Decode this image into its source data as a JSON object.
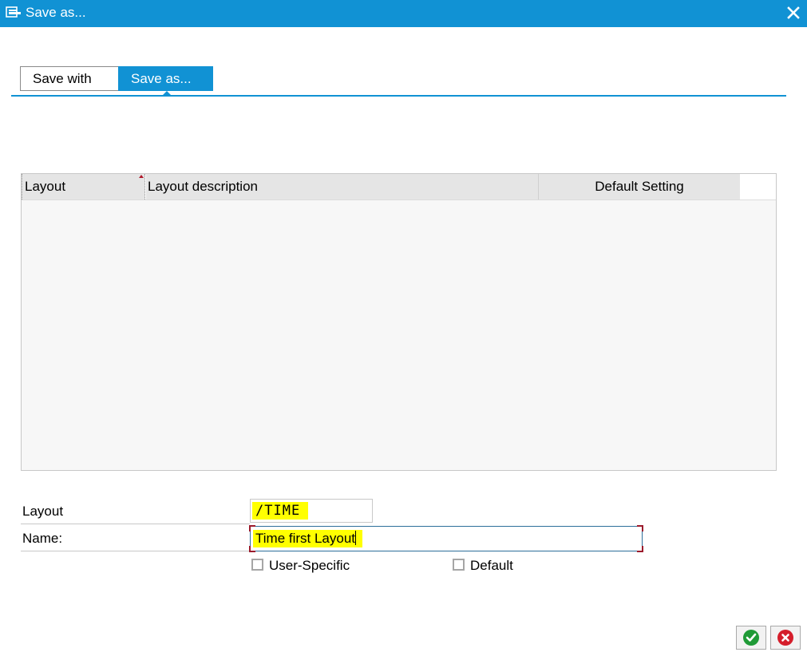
{
  "window": {
    "title": "Save as...",
    "close_icon": "close-icon",
    "title_icon": "save-layout-icon"
  },
  "tabs": [
    {
      "label": "Save with",
      "active": false
    },
    {
      "label": "Save as...",
      "active": true
    }
  ],
  "grid": {
    "columns": [
      "Layout",
      "Layout description",
      "Default Setting"
    ],
    "rows": []
  },
  "form": {
    "layout_label": "Layout",
    "layout_value": "/TIME",
    "name_label": "Name:",
    "name_value": "Time first Layout",
    "user_specific_label": "User-Specific",
    "user_specific_checked": false,
    "default_label": "Default",
    "default_checked": false
  },
  "buttons": {
    "confirm_icon": "checkmark-icon",
    "cancel_icon": "cancel-x-icon"
  },
  "colors": {
    "accent": "#1192d4",
    "highlight": "#ffff00",
    "confirm": "#1f9a36",
    "cancel": "#d51e2b"
  }
}
